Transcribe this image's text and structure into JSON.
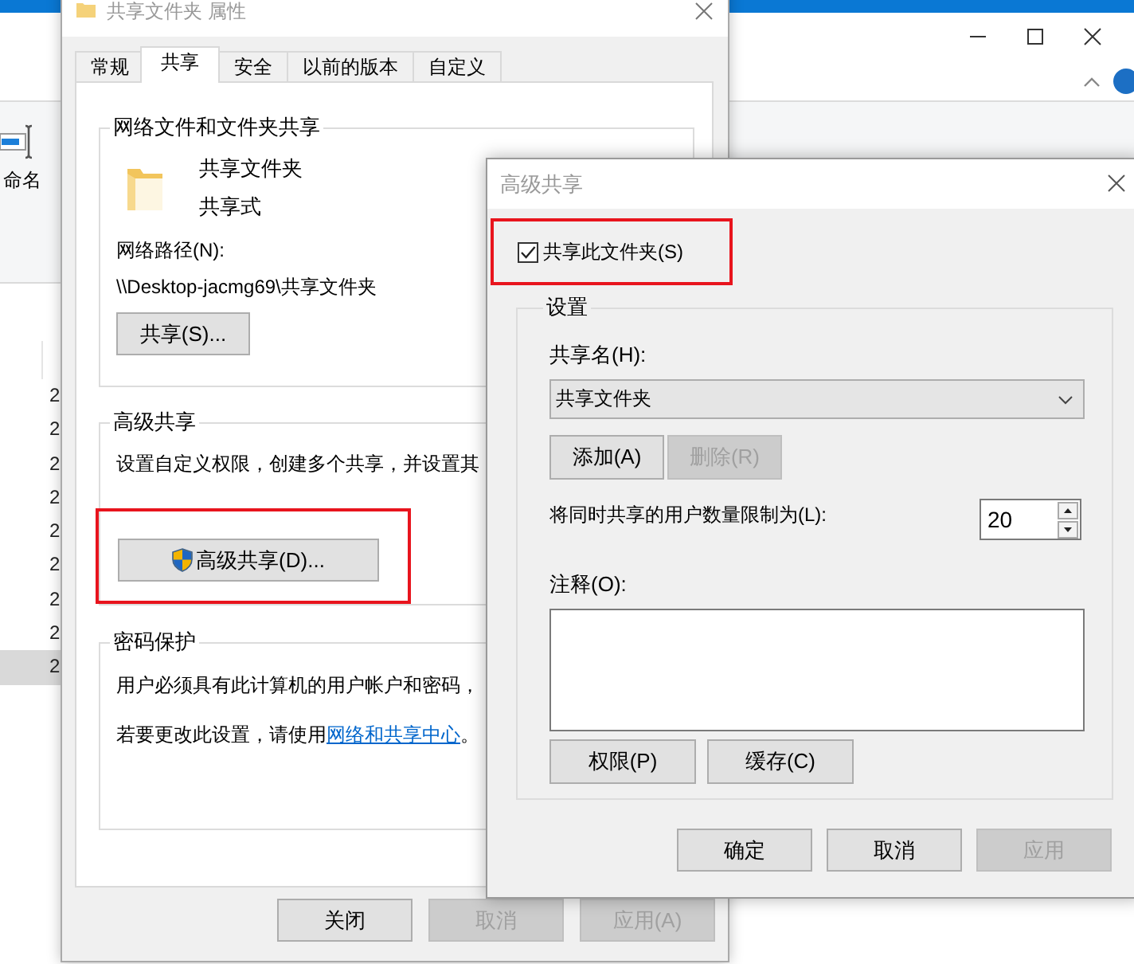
{
  "explorer": {
    "ribbon_label": "命名",
    "list_rows": [
      {
        "cell": "2",
        "selected": false
      },
      {
        "cell": "2",
        "selected": false
      },
      {
        "cell": "2",
        "selected": false
      },
      {
        "cell": "2",
        "selected": false
      },
      {
        "cell": "2",
        "selected": false
      },
      {
        "cell": "2",
        "selected": false
      },
      {
        "cell": "2",
        "selected": false
      },
      {
        "cell": "2",
        "selected": false
      },
      {
        "cell": "2",
        "selected": true
      }
    ]
  },
  "properties": {
    "title": "共享文件夹 属性",
    "tabs": [
      {
        "label": "常规",
        "selected": false
      },
      {
        "label": "共享",
        "selected": true
      },
      {
        "label": "安全",
        "selected": false
      },
      {
        "label": "以前的版本",
        "selected": false
      },
      {
        "label": "自定义",
        "selected": false
      }
    ],
    "network_group": {
      "legend": "网络文件和文件夹共享",
      "folder_name": "共享文件夹",
      "status": "共享式",
      "path_label": "网络路径(N):",
      "path": "\\\\Desktop-jacmg69\\共享文件夹",
      "share_button": "共享(S)..."
    },
    "advanced_group": {
      "legend": "高级共享",
      "description": "设置自定义权限，创建多个共享，并设置其",
      "button": "高级共享(D)...",
      "highlighted": true
    },
    "password_group": {
      "legend": "密码保护",
      "description": "用户必须具有此计算机的用户帐户和密码，",
      "note_prefix": "若要更改此设置，请使用",
      "link": "网络和共享中心",
      "note_suffix": "。"
    },
    "buttons": [
      {
        "label": "关闭",
        "disabled": false
      },
      {
        "label": "取消",
        "disabled": true
      },
      {
        "label": "应用(A)",
        "disabled": true
      }
    ]
  },
  "advanced": {
    "title": "高级共享",
    "share_checkbox": {
      "label": "共享此文件夹(S)",
      "checked": true,
      "highlighted": true
    },
    "settings_legend": "设置",
    "share_name_label": "共享名(H):",
    "share_name": "共享文件夹",
    "name_buttons": [
      {
        "label": "添加(A)",
        "disabled": false
      },
      {
        "label": "删除(R)",
        "disabled": true
      }
    ],
    "limit_label": "将同时共享的用户数量限制为(L):",
    "limit": "20",
    "comment_label": "注释(O):",
    "option_buttons": [
      {
        "label": "权限(P)",
        "disabled": false
      },
      {
        "label": "缓存(C)",
        "disabled": false
      }
    ],
    "buttons": [
      {
        "label": "确定",
        "disabled": false
      },
      {
        "label": "取消",
        "disabled": false
      },
      {
        "label": "应用",
        "disabled": true
      }
    ]
  }
}
